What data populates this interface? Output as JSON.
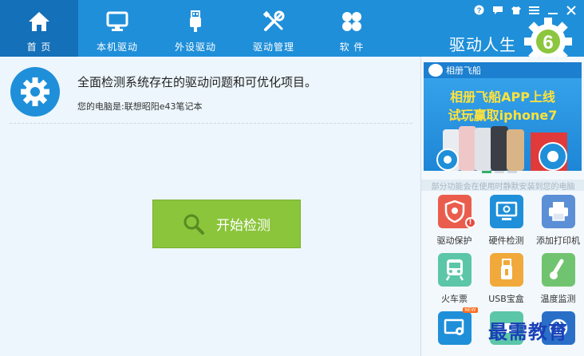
{
  "nav": {
    "items": [
      {
        "label": "首 页",
        "icon": "home-icon"
      },
      {
        "label": "本机驱动",
        "icon": "monitor-icon"
      },
      {
        "label": "外设驱动",
        "icon": "usb-icon"
      },
      {
        "label": "驱动管理",
        "icon": "tools-icon"
      },
      {
        "label": "软 件",
        "icon": "apps-icon"
      }
    ]
  },
  "window_controls": [
    "help-icon",
    "message-icon",
    "skin-icon",
    "menu-icon",
    "minimize-icon",
    "close-icon"
  ],
  "brand": {
    "name": "驱动人生",
    "version_digit": "6"
  },
  "main": {
    "headline": "全面检测系统存在的驱动问题和可优化项目。",
    "pc_info": "您的电脑是:联想昭阳e43笔记本",
    "start_button": "开始检测"
  },
  "ad": {
    "brand": "相册飞船",
    "line1": "相册飞船APP上线",
    "line2": "试玩赢取iphone7"
  },
  "tip": "部分功能会在使用时静默安装到您的电脑",
  "tools": [
    {
      "name": "驱动保护",
      "color": "#ea5d4d"
    },
    {
      "name": "硬件检测",
      "color": "#1f8fd9"
    },
    {
      "name": "添加打印机",
      "color": "#5b8fd6"
    },
    {
      "name": "火车票",
      "color": "#5cc6a8"
    },
    {
      "name": "USB宝盒",
      "color": "#f0a93a"
    },
    {
      "name": "温度监测",
      "color": "#71c46f"
    },
    {
      "name": "",
      "color": "#1f8fd9"
    },
    {
      "name": "",
      "color": "#5cc6a8"
    },
    {
      "name": "",
      "color": "#2a6fc7"
    }
  ],
  "new_tag": "NEW",
  "watermark": "最需教育"
}
